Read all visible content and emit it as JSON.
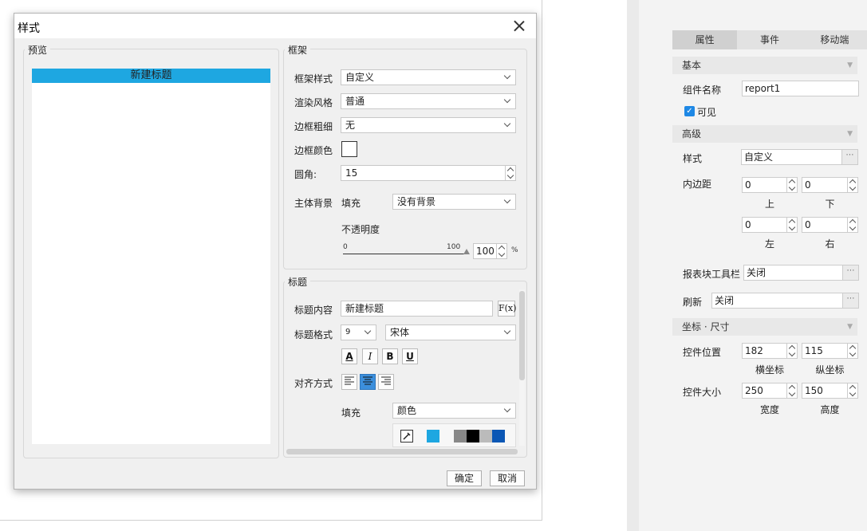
{
  "dialog": {
    "title": "样式",
    "preview": {
      "group_label": "预览",
      "title_text": "新建标题",
      "title_bar_color": "#1ea7e1"
    },
    "frame": {
      "group_label": "框架",
      "frame_style": {
        "label": "框架样式",
        "value": "自定义"
      },
      "render_style": {
        "label": "渲染风格",
        "value": "普通"
      },
      "border_width": {
        "label": "边框粗细",
        "value": "无"
      },
      "border_color": {
        "label": "边框颜色"
      },
      "radius": {
        "label": "圆角:",
        "value": "15"
      },
      "body_bg": {
        "label": "主体背景",
        "fill_label": "填充",
        "value": "没有背景"
      },
      "opacity": {
        "label": "不透明度",
        "min": "0",
        "max": "100",
        "value": "100",
        "unit": "%",
        "level": 100
      }
    },
    "title_section": {
      "group_label": "标题",
      "content": {
        "label": "标题内容",
        "value": "新建标题",
        "fx_label": "F(x)"
      },
      "format": {
        "label": "标题格式",
        "size": "9",
        "font": "宋体"
      },
      "buttons": {
        "color": "A",
        "italic": "I",
        "bold": "B",
        "underline": "U"
      },
      "align": {
        "label": "对齐方式",
        "selected": "center"
      },
      "fill": {
        "label": "填充",
        "value": "颜色"
      },
      "palette": [
        "#1ea7e1",
        "#ffffff",
        "#888888",
        "#000000",
        "#bbbbbb",
        "#0b57b5"
      ]
    },
    "ok_label": "确定",
    "cancel_label": "取消"
  },
  "right_panel": {
    "tabs": [
      "属性",
      "事件",
      "移动端"
    ],
    "basic": {
      "header": "基本",
      "name_label": "组件名称",
      "name_value": "report1",
      "visible_label": "可见",
      "visible_checked": true
    },
    "advanced": {
      "header": "高级",
      "style_label": "样式",
      "style_value": "自定义",
      "padding_label": "内边距",
      "padding": {
        "top": "0",
        "bottom": "0",
        "left": "0",
        "right": "0"
      },
      "padding_captions": {
        "top": "上",
        "bottom": "下",
        "left": "左",
        "right": "右"
      },
      "toolbar_label": "报表块工具栏",
      "toolbar_value": "关闭",
      "refresh_label": "刷新",
      "refresh_value": "关闭"
    },
    "geometry": {
      "header": "坐标 · 尺寸",
      "position_label": "控件位置",
      "x_value": "182",
      "y_value": "115",
      "x_caption": "横坐标",
      "y_caption": "纵坐标",
      "size_label": "控件大小",
      "w_value": "250",
      "h_value": "150",
      "w_caption": "宽度",
      "h_caption": "高度"
    }
  }
}
